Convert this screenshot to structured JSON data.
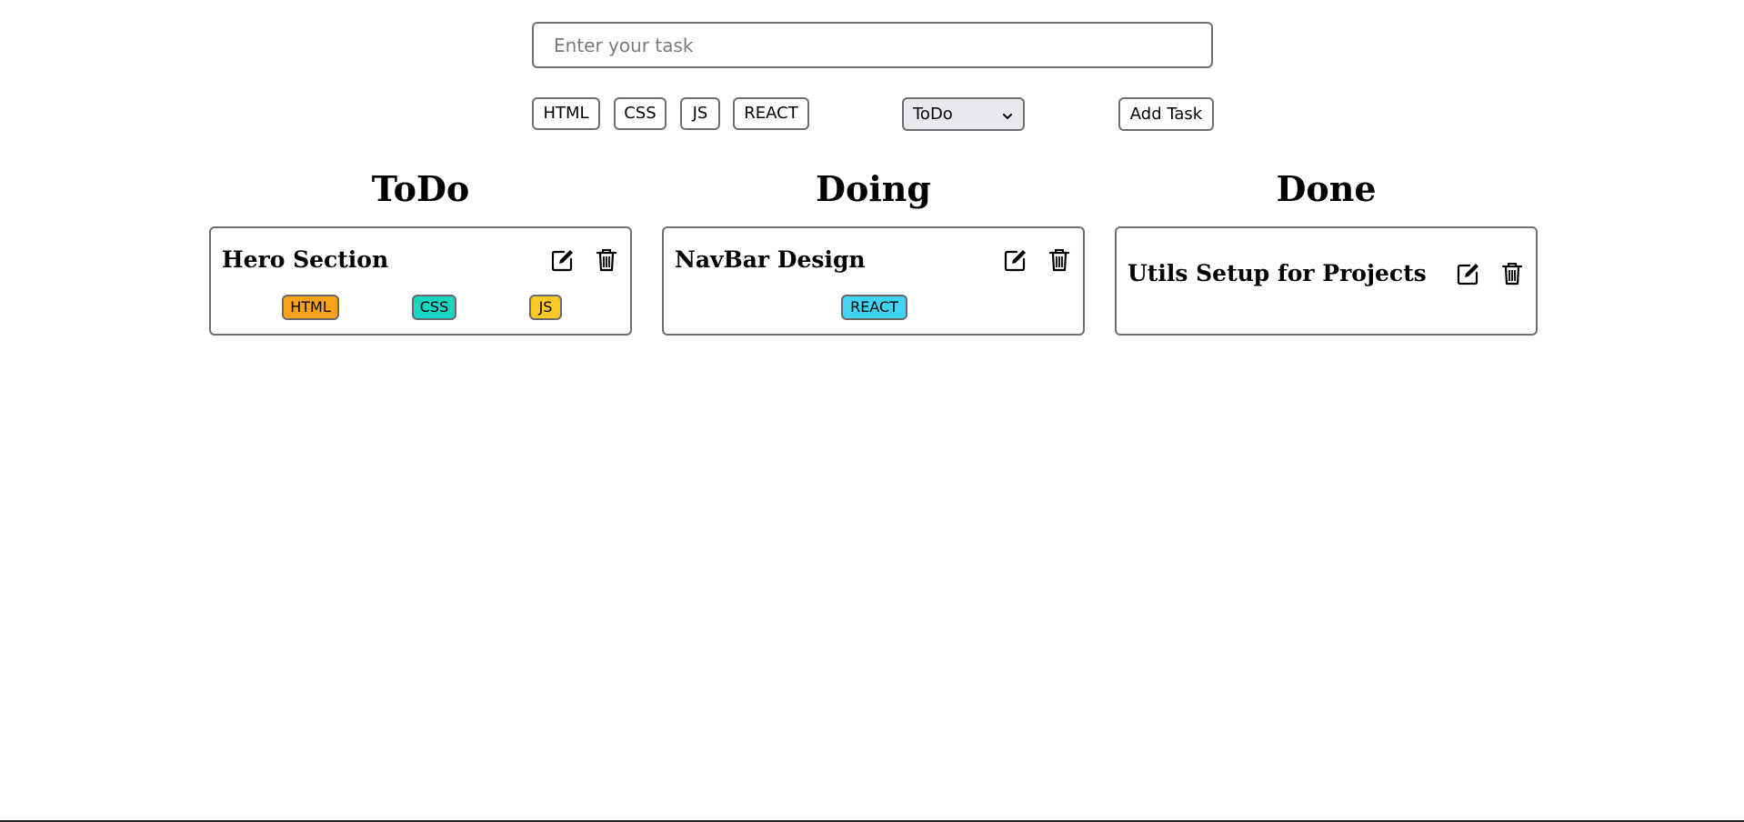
{
  "form": {
    "task_placeholder": "Enter your task",
    "task_value": "",
    "tags": [
      {
        "label": "HTML"
      },
      {
        "label": "CSS"
      },
      {
        "label": "JS"
      },
      {
        "label": "REACT"
      }
    ],
    "status_selected": "ToDo",
    "add_label": "Add Task"
  },
  "columns": [
    {
      "heading": "ToDo",
      "cards": [
        {
          "title": "Hero Section",
          "tags": [
            {
              "label": "HTML",
              "color": "#f9a11b"
            },
            {
              "label": "CSS",
              "color": "#16d5c1"
            },
            {
              "label": "JS",
              "color": "#f7ca26"
            }
          ]
        }
      ]
    },
    {
      "heading": "Doing",
      "cards": [
        {
          "title": "NavBar Design",
          "tags": [
            {
              "label": "REACT",
              "color": "#3fd3f4"
            }
          ]
        }
      ]
    },
    {
      "heading": "Done",
      "cards": [
        {
          "title": "Utils Setup for Projects",
          "tags": []
        }
      ]
    }
  ],
  "icons": {
    "edit": "edit-icon",
    "delete": "trash-icon",
    "dropdown": "chevron-down-icon"
  }
}
